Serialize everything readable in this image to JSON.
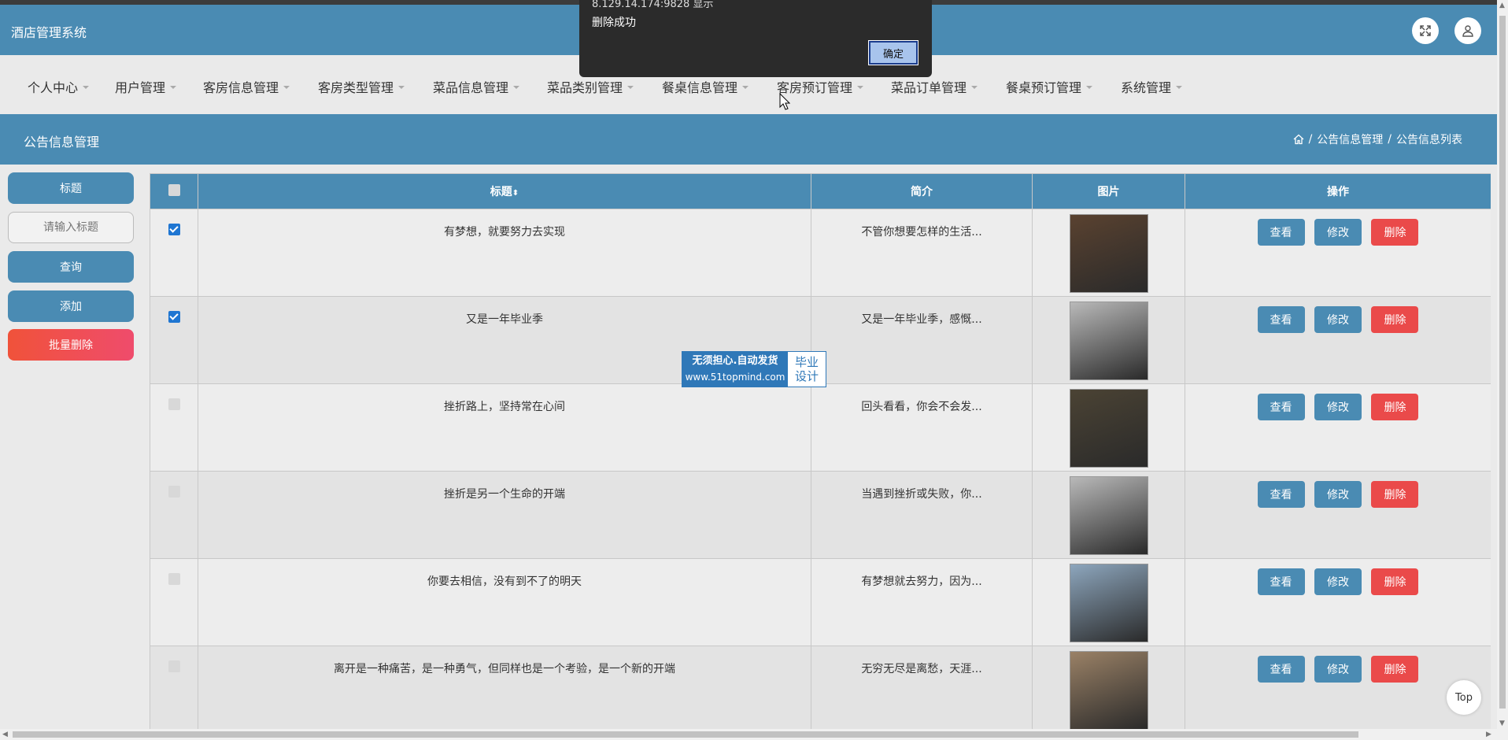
{
  "app": {
    "title": "酒店管理系统"
  },
  "nav": [
    {
      "label": "个人中心"
    },
    {
      "label": "用户管理"
    },
    {
      "label": "客房信息管理"
    },
    {
      "label": "客房类型管理"
    },
    {
      "label": "菜品信息管理"
    },
    {
      "label": "菜品类别管理"
    },
    {
      "label": "餐桌信息管理"
    },
    {
      "label": "客房预订管理"
    },
    {
      "label": "菜品订单管理"
    },
    {
      "label": "餐桌预订管理"
    },
    {
      "label": "系统管理"
    }
  ],
  "page": {
    "title": "公告信息管理",
    "breadcrumb": [
      "公告信息管理",
      "公告信息列表"
    ]
  },
  "sidebar": {
    "label_title": "标题",
    "search_placeholder": "请输入标题",
    "query": "查询",
    "add": "添加",
    "batch_delete": "批量删除"
  },
  "table": {
    "headers": {
      "title": "标题",
      "sort_glyph": "⬍",
      "summary": "简介",
      "image": "图片",
      "ops": "操作"
    },
    "rows": [
      {
        "checked": true,
        "title": "有梦想，就要努力去实现",
        "summary": "不管你想要怎样的生活...",
        "img": "#5a4230"
      },
      {
        "checked": true,
        "title": "又是一年毕业季",
        "summary": "又是一年毕业季，感慨...",
        "img": "#b9b9b9"
      },
      {
        "checked": false,
        "title": "挫折路上，坚持常在心间",
        "summary": "回头看看，你会不会发...",
        "img": "#4b4334"
      },
      {
        "checked": false,
        "title": "挫折是另一个生命的开端",
        "summary": "当遇到挫折或失败，你...",
        "img": "#b9b9b9"
      },
      {
        "checked": false,
        "title": "你要去相信，没有到不了的明天",
        "summary": "有梦想就去努力，因为...",
        "img": "#8da6bd"
      },
      {
        "checked": false,
        "title": "离开是一种痛苦，是一种勇气，但同样也是一个考验，是一个新的开端",
        "summary": "无穷无尽是离愁，天涯...",
        "img": "#9a8166"
      }
    ],
    "actions": {
      "view": "查看",
      "edit": "修改",
      "delete": "删除"
    }
  },
  "dialog": {
    "source": "8.129.14.174:9828 显示",
    "message": "删除成功",
    "ok": "确定"
  },
  "watermark": {
    "line1": "无须担心.自动发货",
    "url": "www.51topmind.com",
    "right1": "毕业",
    "right2": "设计"
  },
  "to_top": "Top",
  "colors": {
    "primary": "#4a8bb3",
    "danger": "#ea4a4a",
    "checkbox": "#1f76d2"
  }
}
